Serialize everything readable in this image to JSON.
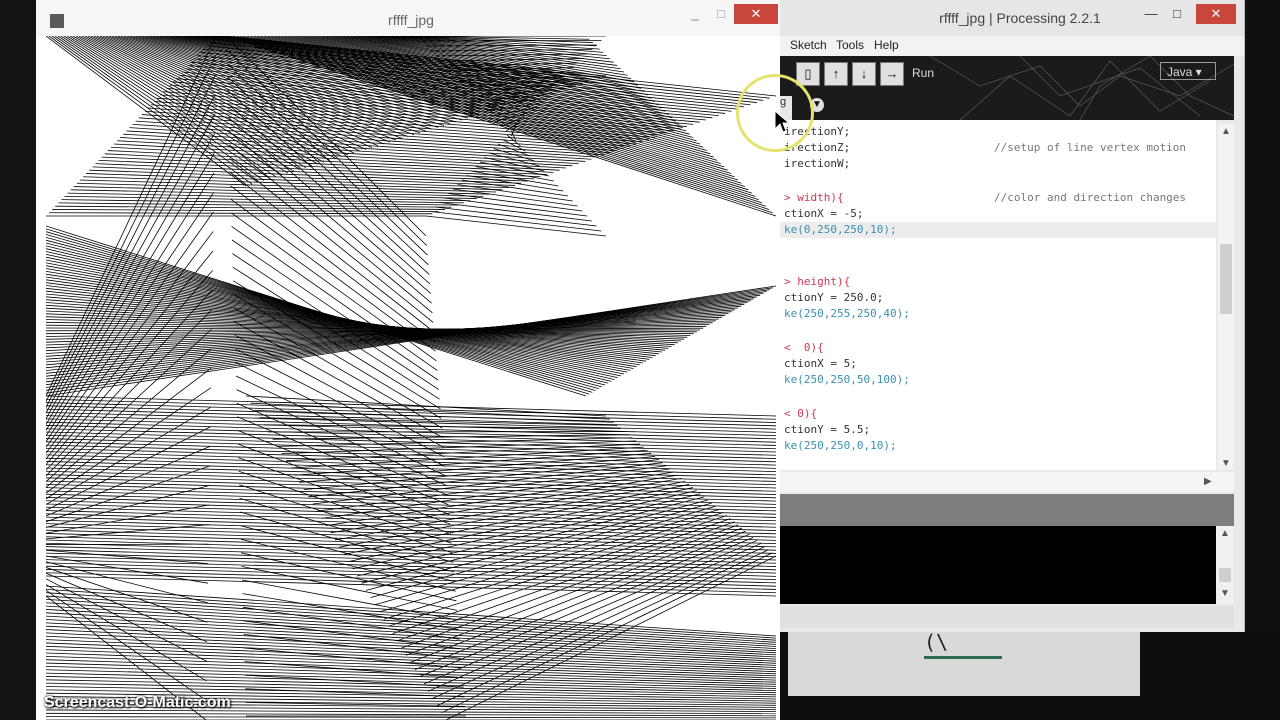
{
  "sketch_window": {
    "title": "rffff_jpg",
    "minimize": "_",
    "maximize": "□",
    "close": "✕"
  },
  "ide_window": {
    "title": "rffff_jpg | Processing 2.2.1",
    "minimize": "—",
    "maximize": "□",
    "close": "✕",
    "menu": [
      "Sketch",
      "Tools",
      "Help"
    ],
    "toolbar": {
      "new_icon": "new-file-icon",
      "open_icon": "open-icon",
      "save_icon": "save-icon",
      "export_icon": "export-icon",
      "run_label": "Run",
      "mode": "Java ▾"
    },
    "tab_label": "g",
    "code_lines": [
      {
        "text": "irectionY;",
        "comment": ""
      },
      {
        "text": "irectionZ;",
        "comment": "//setup of line vertex motion"
      },
      {
        "text": "irectionW;",
        "comment": ""
      },
      {
        "text": "",
        "comment": ""
      },
      {
        "text": "> width){",
        "comment": "//color and direction changes"
      },
      {
        "text": "ctionX = -5;",
        "comment": ""
      },
      {
        "text": "ke(0,250,250,10);",
        "comment": ""
      },
      {
        "text": "",
        "comment": ""
      },
      {
        "text": "",
        "comment": ""
      },
      {
        "text": "> height){",
        "comment": ""
      },
      {
        "text": "ctionY = 250.0;",
        "comment": ""
      },
      {
        "text": "ke(250,255,250,40);",
        "comment": ""
      },
      {
        "text": "",
        "comment": ""
      },
      {
        "text": "<  0){",
        "comment": ""
      },
      {
        "text": "ctionX = 5;",
        "comment": ""
      },
      {
        "text": "ke(250,250,50,100);",
        "comment": ""
      },
      {
        "text": "",
        "comment": ""
      },
      {
        "text": "< 0){",
        "comment": ""
      },
      {
        "text": "ctionY = 5.5;",
        "comment": ""
      },
      {
        "text": "ke(250,250,0,10);",
        "comment": ""
      }
    ]
  },
  "background_window": {
    "glyph": "(\\"
  },
  "watermark": "Screencast-O-Matic.com",
  "colors": {
    "close_button": "#c9463d",
    "keyword": "#cc3a55",
    "function": "#3a8fb0",
    "cursor_highlight": "#e5e36a"
  }
}
